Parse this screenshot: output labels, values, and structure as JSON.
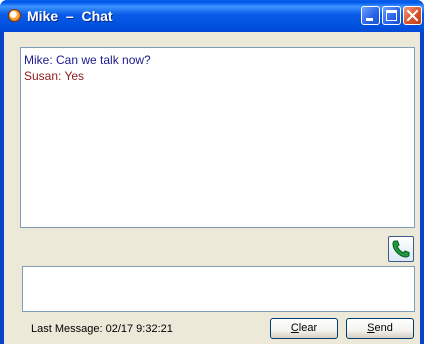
{
  "window": {
    "title": "Mike  –  Chat",
    "app_icon": "chat-app-icon",
    "controls": {
      "minimize": "minimize-icon",
      "maximize": "maximize-icon",
      "close": "close-icon"
    }
  },
  "messages": [
    {
      "text": "Mike: Can we talk now?",
      "sender": "Mike",
      "color": "#1a1a8c"
    },
    {
      "text": "Susan: Yes",
      "sender": "Susan",
      "color": "#8c1a1a"
    }
  ],
  "call_button": {
    "icon": "phone-icon",
    "color": "#1e9a3a"
  },
  "compose": {
    "value": "",
    "placeholder": ""
  },
  "status": {
    "last_message": "Last Message: 02/17 9:32:21"
  },
  "buttons": {
    "clear": {
      "mnemonic": "C",
      "rest": "lear"
    },
    "send": {
      "mnemonic": "S",
      "rest": "end"
    }
  },
  "colors": {
    "titlebar": "#0058ee",
    "client_bg": "#ece9d8",
    "close_button": "#d8542c"
  }
}
